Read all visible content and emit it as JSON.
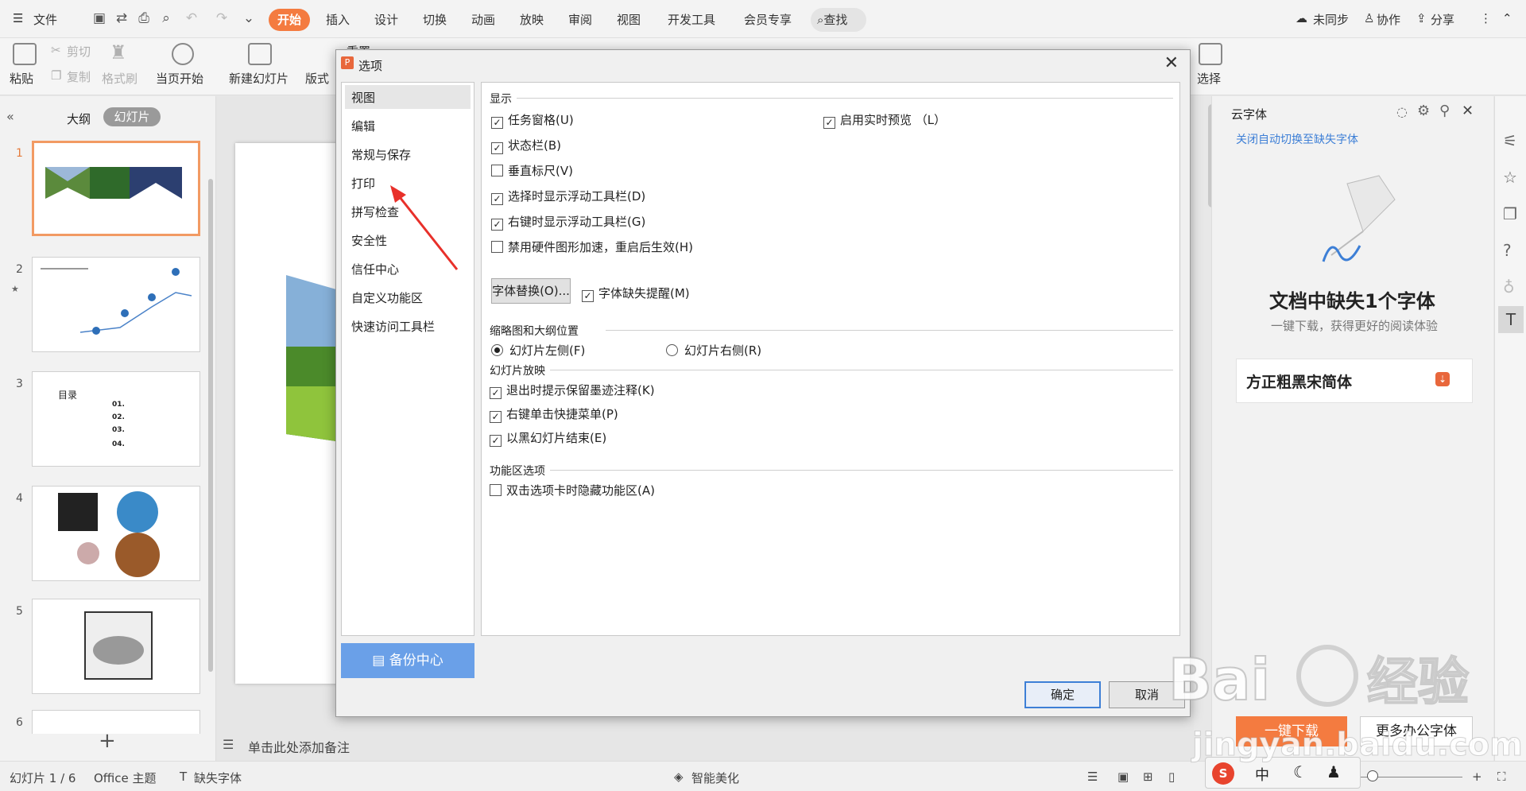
{
  "menubar": {
    "file": "文件",
    "tabs": [
      "开始",
      "插入",
      "设计",
      "切换",
      "动画",
      "放映",
      "审阅",
      "视图",
      "开发工具",
      "会员专享"
    ],
    "search": "查找",
    "sync": "未同步",
    "collab": "协作",
    "share": "分享"
  },
  "ribbon": {
    "paste": "粘贴",
    "cut": "剪切",
    "copy": "复制",
    "format_painter": "格式刷",
    "from_current": "当页开始",
    "new_slide": "新建幻灯片",
    "layout": "版式",
    "reset": "重置",
    "select": "选择"
  },
  "leftpanel": {
    "tab_outline": "大纲",
    "tab_slides": "幻灯片",
    "slides": [
      "1",
      "2",
      "3",
      "4",
      "5",
      "6"
    ],
    "slide3_title": "目录",
    "slide3_items": [
      "01.",
      "02.",
      "03.",
      "04."
    ],
    "add": "+"
  },
  "canvas": {
    "notes_placeholder": "单击此处添加备注"
  },
  "rightpanel": {
    "header": "云字体",
    "link": "关闭自动切换至缺失字体",
    "title": "文档中缺失1个字体",
    "subtitle": "一键下载，获得更好的阅读体验",
    "font_name": "方正粗黑宋简体",
    "download": "一键下载",
    "more_fonts": "更多办公字体"
  },
  "statusbar": {
    "slide_counter": "幻灯片 1 / 6",
    "theme": "Office 主题",
    "missing_font": "缺失字体",
    "beautify": "智能美化"
  },
  "dialog": {
    "title": "选项",
    "nav": [
      "视图",
      "编辑",
      "常规与保存",
      "打印",
      "拼写检查",
      "安全性",
      "信任中心",
      "自定义功能区",
      "快速访问工具栏"
    ],
    "backup": "备份中心",
    "sections": {
      "display": "显示",
      "thumb_outline_pos": "缩略图和大纲位置",
      "slideshow": "幻灯片放映",
      "ribbon_opts": "功能区选项"
    },
    "display_options": [
      {
        "label": "任务窗格(U)",
        "checked": true
      },
      {
        "label": "状态栏(B)",
        "checked": true
      },
      {
        "label": "垂直标尺(V)",
        "checked": false
      },
      {
        "label": "选择时显示浮动工具栏(D)",
        "checked": true
      },
      {
        "label": "右键时显示浮动工具栏(G)",
        "checked": true
      },
      {
        "label": "禁用硬件图形加速，重启后生效(H)",
        "checked": false
      }
    ],
    "live_preview": {
      "label": "启用实时预览 （L）",
      "checked": true
    },
    "font_replace": "字体替换(O)...",
    "font_missing_alert": {
      "label": "字体缺失提醒(M)",
      "checked": true
    },
    "position_options": [
      {
        "label": "幻灯片左侧(F)",
        "selected": true
      },
      {
        "label": "幻灯片右侧(R)",
        "selected": false
      }
    ],
    "slideshow_options": [
      {
        "label": "退出时提示保留墨迹注释(K)",
        "checked": true
      },
      {
        "label": "右键单击快捷菜单(P)",
        "checked": true
      },
      {
        "label": "以黑幻灯片结束(E)",
        "checked": true
      }
    ],
    "ribbon_options": [
      {
        "label": "双击选项卡时隐藏功能区(A)",
        "checked": false
      }
    ],
    "ok": "确定",
    "cancel": "取消"
  },
  "watermark": {
    "brand": "Baidu经验",
    "url": "jingyan.baidu.com"
  },
  "colors": {
    "accent": "#f47b40",
    "arrow": "#e8302a",
    "link": "#3d7fd6",
    "backup": "#6aa0e8"
  }
}
